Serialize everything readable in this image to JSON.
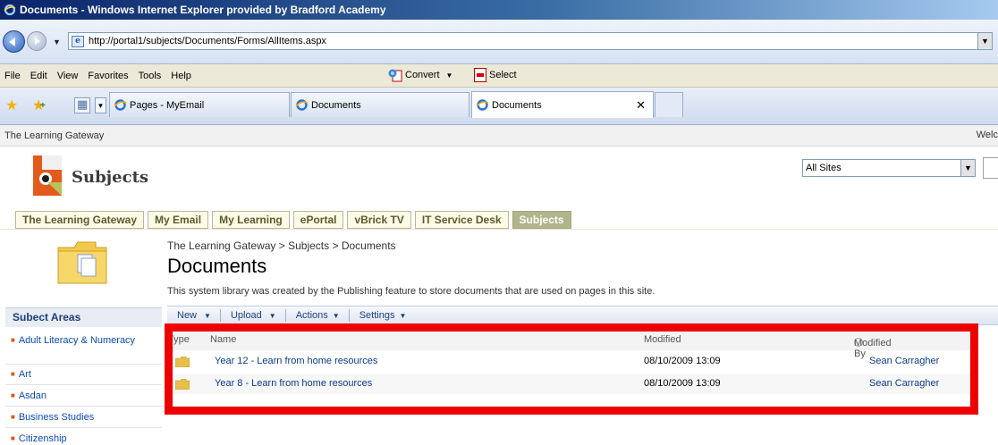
{
  "window": {
    "title": "Documents - Windows Internet Explorer provided by Bradford Academy"
  },
  "address_bar": {
    "url": "http://portal1/subjects/Documents/Forms/AllItems.aspx"
  },
  "menu": {
    "items": [
      "File",
      "Edit",
      "View",
      "Favorites",
      "Tools",
      "Help"
    ],
    "convert_label": "Convert",
    "select_label": "Select"
  },
  "browser_tabs": [
    {
      "label": "Pages - MyEmail",
      "active": false
    },
    {
      "label": "Documents",
      "active": false
    },
    {
      "label": "Documents",
      "active": true
    }
  ],
  "topstrip": {
    "site_name": "The Learning Gateway",
    "welcome": "Welc"
  },
  "site": {
    "title": "Subjects",
    "search_scope": "All Sites"
  },
  "top_nav": [
    {
      "label": "The Learning Gateway",
      "selected": false
    },
    {
      "label": "My Email",
      "selected": false
    },
    {
      "label": "My Learning",
      "selected": false
    },
    {
      "label": "ePortal",
      "selected": false
    },
    {
      "label": "vBrick TV",
      "selected": false
    },
    {
      "label": "IT Service Desk",
      "selected": false
    },
    {
      "label": "Subjects",
      "selected": true
    }
  ],
  "quick_launch": {
    "heading": "Subect Areas",
    "items": [
      "Adult Literacy & Numeracy",
      "Art",
      "Asdan",
      "Business Studies",
      "Citizenship"
    ]
  },
  "breadcrumb": {
    "items": [
      "The Learning Gateway",
      "Subjects",
      "Documents"
    ],
    "separator": ">"
  },
  "page": {
    "title": "Documents",
    "description": "This system library was created by the Publishing feature to store documents that are used on pages in this site."
  },
  "toolbar": {
    "new_label": "New",
    "upload_label": "Upload",
    "actions_label": "Actions",
    "settings_label": "Settings"
  },
  "list": {
    "columns": {
      "type": "Type",
      "name": "Name",
      "modified": "Modified",
      "modified_by": "Modified By"
    },
    "rows": [
      {
        "name": "Year 12 - Learn from home resources",
        "modified": "08/10/2009 13:09",
        "modified_by": "Sean Carragher"
      },
      {
        "name": "Year 8 - Learn from home resources",
        "modified": "08/10/2009 13:09",
        "modified_by": "Sean Carragher"
      }
    ]
  },
  "colors": {
    "highlight_box": "#ee0000",
    "selected_nav": "#b2b48b",
    "link": "#0b3a8d"
  }
}
